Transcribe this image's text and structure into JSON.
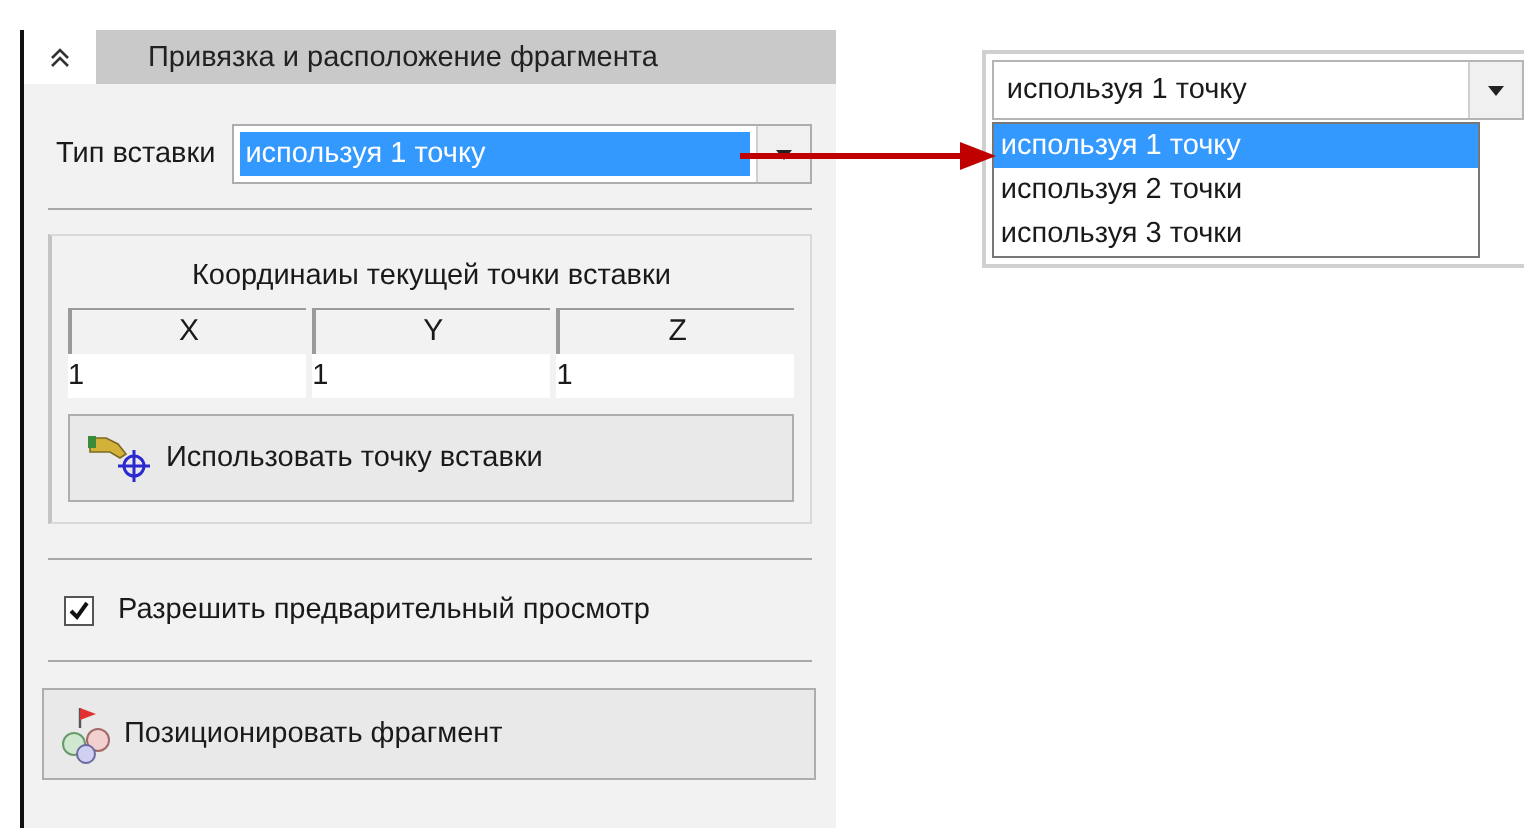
{
  "panel": {
    "title": "Привязка и расположение фрагмента",
    "expanded": true
  },
  "insert_type": {
    "label": "Тип вставки",
    "value": "используя 1 точку"
  },
  "coordinates": {
    "title": "Координаиы текущей точки вставки",
    "columns": [
      "X",
      "Y",
      "Z"
    ],
    "values": [
      "1",
      "1",
      "1"
    ],
    "button": "Использовать точку вставки"
  },
  "preview": {
    "label": "Разрешить предварительный просмотр",
    "checked": true
  },
  "position_button": "Позиционировать фрагмент",
  "dropdown": {
    "value": "используя 1 точку",
    "options": [
      {
        "label": "используя 1 точку",
        "selected": true
      },
      {
        "label": "используя 2 точки",
        "selected": false
      },
      {
        "label": "используя 3 точки",
        "selected": false
      }
    ]
  }
}
